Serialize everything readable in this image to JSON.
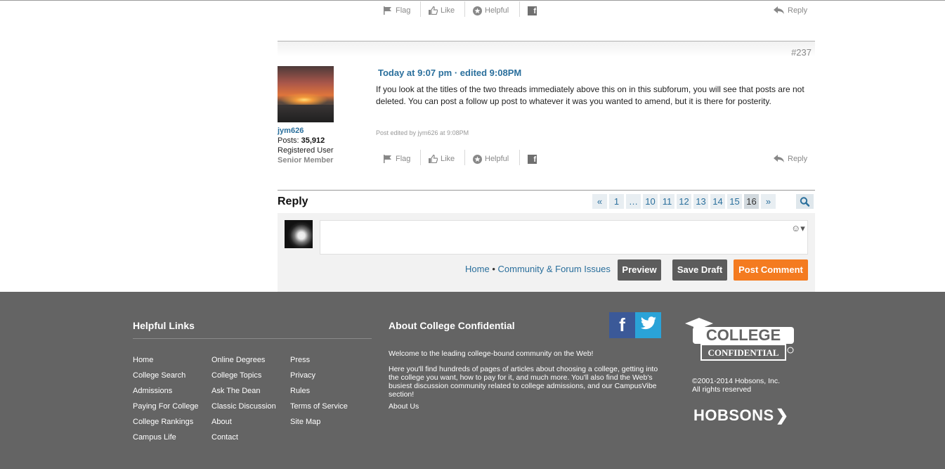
{
  "prev_post_actions": {
    "flag": "Flag",
    "like": "Like",
    "helpful": "Helpful",
    "reply": "Reply"
  },
  "post": {
    "number": "#237",
    "author": "jym626",
    "posts_label": "Posts:",
    "posts_count": "35,912",
    "role": "Registered User",
    "rank": "Senior Member",
    "timestamp": "Today at 9:07 pm · edited 9:08PM",
    "body": "If you look at the titles of the two threads immediately above this on in this subforum, you will see that posts are not deleted. You can post a follow up post to whatever it was you wanted to amend, but it is there for posterity.",
    "edit_note": "Post edited by jym626 at 9:08PM",
    "actions": {
      "flag": "Flag",
      "like": "Like",
      "helpful": "Helpful",
      "reply": "Reply"
    }
  },
  "reply": {
    "heading": "Reply",
    "pagination": {
      "prev": "«",
      "pages": [
        "1",
        "…",
        "10",
        "11",
        "12",
        "13",
        "14",
        "15",
        "16"
      ],
      "current": "16",
      "next": "»"
    },
    "breadcrumb": {
      "home": "Home",
      "separator": "•",
      "section": "Community & Forum Issues"
    },
    "buttons": {
      "preview": "Preview",
      "save_draft": "Save Draft",
      "post_comment": "Post Comment"
    },
    "smiley": "☺▾"
  },
  "footer": {
    "helpful_links_heading": "Helpful Links",
    "links_col1": [
      "Home",
      "College Search",
      "Admissions",
      "Paying For College",
      "College Rankings",
      "Campus Life"
    ],
    "links_col2": [
      "Online Degrees",
      "College Topics",
      "Ask The Dean",
      "Classic Discussion",
      "About",
      "Contact"
    ],
    "links_col3": [
      "Press",
      "Privacy",
      "Rules",
      "Terms of Service",
      "Site Map"
    ],
    "about_heading": "About College Confidential",
    "about_intro": "Welcome to the leading college-bound community on the Web!",
    "about_text": "Here you'll find hundreds of pages of articles about choosing a college, getting into the college you want, how to pay for it, and much more. You'll also find the Web's busiest discussion community related to college admissions, and our CampusVibe section!",
    "about_link": "About Us",
    "logo_line1": "COLLEGE",
    "logo_line2": "CONFIDENTIAL",
    "copyright_line1": "©2001-2014 Hobsons, Inc.",
    "copyright_line2": "All rights reserved",
    "hobsons": "HOBSONS"
  },
  "colors": {
    "link": "#2a6f9c",
    "footer_bg": "#646464",
    "post_comment": "#f47b20",
    "dark_button": "#5c5c5c",
    "facebook": "#3b5998",
    "twitter": "#2aa3d8"
  }
}
